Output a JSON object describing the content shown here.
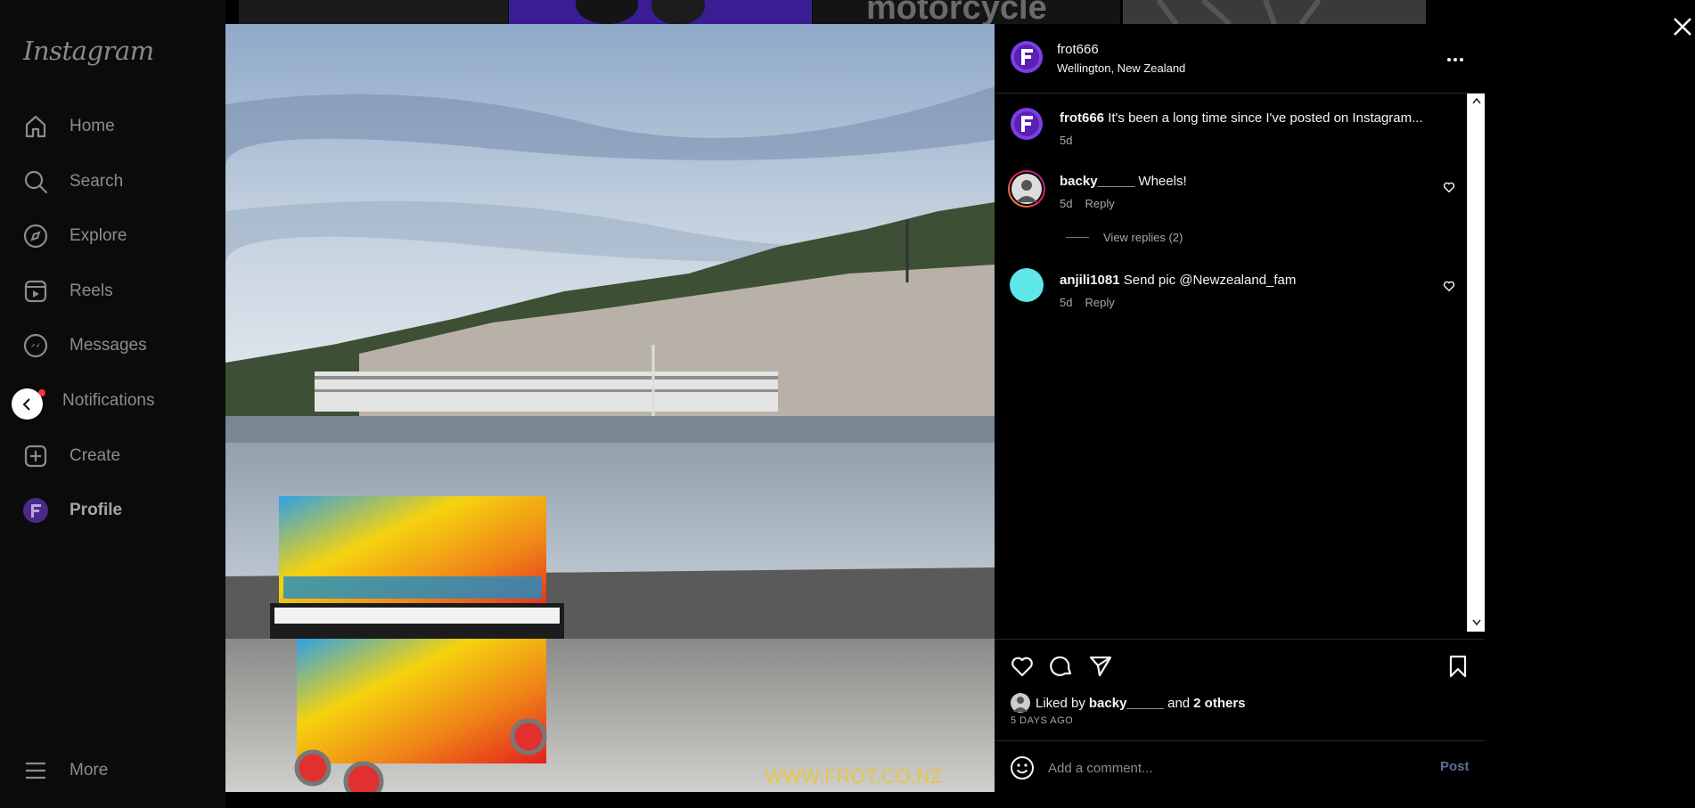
{
  "app": {
    "logo_text": "Instagram"
  },
  "sidebar": {
    "items": [
      {
        "label": "Home",
        "icon": "home-icon"
      },
      {
        "label": "Search",
        "icon": "search-icon"
      },
      {
        "label": "Explore",
        "icon": "compass-icon"
      },
      {
        "label": "Reels",
        "icon": "reels-icon"
      },
      {
        "label": "Messages",
        "icon": "messenger-icon"
      },
      {
        "label": "Notifications",
        "icon": "heart-icon"
      },
      {
        "label": "Create",
        "icon": "plus-square-icon"
      },
      {
        "label": "Profile",
        "icon": "avatar"
      }
    ],
    "more_label": "More"
  },
  "background": {
    "strip_text": "motorcycle"
  },
  "post": {
    "watermark": "WWW.FROT.CO.NZ",
    "author": {
      "username": "frot666",
      "location": "Wellington, New Zealand"
    },
    "caption": {
      "username": "frot666",
      "text": "It's been a long time since I've posted on Instagram...",
      "time": "5d"
    },
    "comments": [
      {
        "username": "backy_____",
        "text": "Wheels!",
        "time": "5d",
        "reply_label": "Reply",
        "view_replies": "View replies (2)"
      },
      {
        "username": "anjili1081",
        "text": "Send pic @Newzealand_fam",
        "time": "5d",
        "reply_label": "Reply"
      }
    ],
    "likes": {
      "prefix": "Liked by",
      "liker": "backy_____",
      "joiner": "and",
      "others": "2 others"
    },
    "date_label": "5 DAYS AGO",
    "comment_placeholder": "Add a comment...",
    "post_label": "Post"
  },
  "colors": {
    "brand_avatar": "#7b3fe4",
    "teal_avatar": "#5ee6e8",
    "post_button": "#5a6f96"
  }
}
